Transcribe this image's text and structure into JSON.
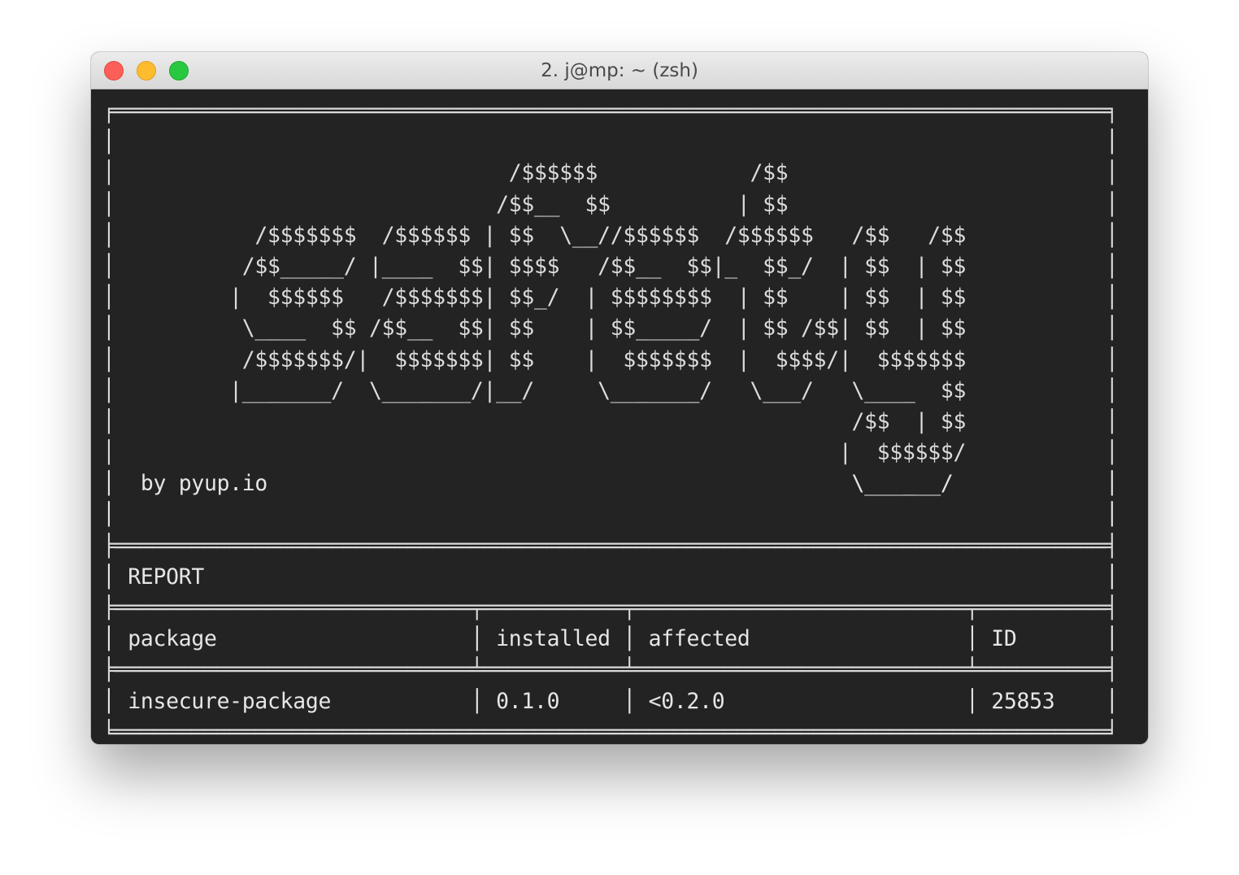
{
  "window": {
    "title": "2. j@mp: ~ (zsh)"
  },
  "terminal": {
    "lines": [
      "╒══════════════════════════════════════════════════════════════════════════════╕",
      "│                                                                              │",
      "│                               /$$$$$$            /$$                         │",
      "│                              /$$__  $$          | $$                         │",
      "│           /$$$$$$$  /$$$$$$ | $$  \\__//$$$$$$  /$$$$$$   /$$   /$$           │",
      "│          /$$_____/ |____  $$| $$$$   /$$__  $$|_  $$_/  | $$  | $$           │",
      "│         |  $$$$$$   /$$$$$$$| $$_/  | $$$$$$$$  | $$    | $$  | $$           │",
      "│          \\____  $$ /$$__  $$| $$    | $$_____/  | $$ /$$| $$  | $$           │",
      "│          /$$$$$$$/|  $$$$$$$| $$    |  $$$$$$$  |  $$$$/|  $$$$$$$           │",
      "│         |_______/  \\_______/|__/     \\_______/   \\___/   \\____  $$           │",
      "│                                                          /$$  | $$           │",
      "│                                                         |  $$$$$$/           │",
      "│  by pyup.io                                              \\______/            │",
      "│                                                                              │",
      "╞══════════════════════════════════════════════════════════════════════════════╡",
      "│ REPORT                                                                       │",
      "╞════════════════════════════╤═══════════╤══════════════════════════╤══════════╡",
      "│ package                    │ installed │ affected                 │ ID       │",
      "╞════════════════════════════╧═══════════╧══════════════════════════╧══════════╡",
      "│ insecure-package           │ 0.1.0     │ <0.2.0                   │ 25853    │",
      "╘══════════════════════════════════════════════════════════════════════════════╛"
    ],
    "report": {
      "heading": "REPORT",
      "columns": [
        "package",
        "installed",
        "affected",
        "ID"
      ],
      "rows": [
        [
          "insecure-package",
          "0.1.0",
          "<0.2.0",
          "25853"
        ]
      ]
    },
    "credit": "by pyup.io"
  },
  "colors": {
    "terminal_bg": "#232323",
    "terminal_fg": "#e6e6e6",
    "titlebar": "#e0e0e0",
    "close": "#fc5f57",
    "minimize": "#fdbc2e",
    "maximize": "#28c840"
  }
}
